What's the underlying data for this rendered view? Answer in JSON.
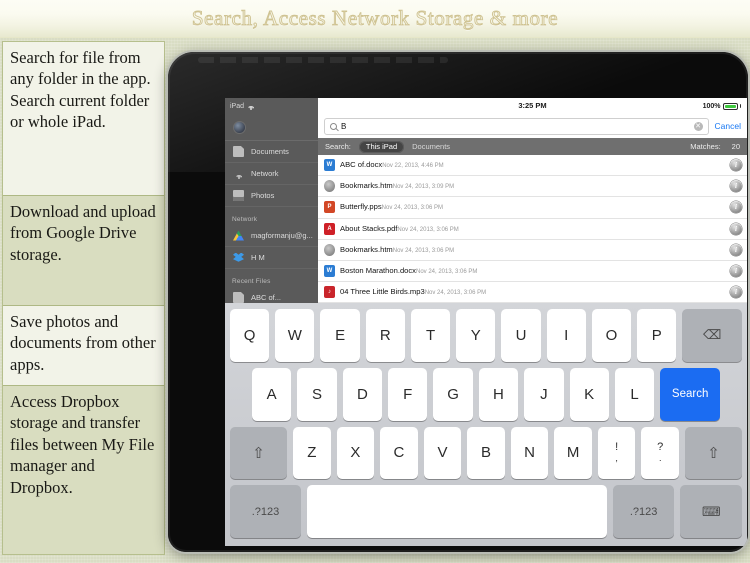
{
  "header": {
    "title": "Search, Access Network Storage & more"
  },
  "features": [
    {
      "text": "Search for file from any folder in the app.\nSearch current folder or whole iPad."
    },
    {
      "text": "Download and upload from Google Drive storage."
    },
    {
      "text": "Save photos and documents from other apps."
    },
    {
      "text": "Access Dropbox storage and transfer files between My File manager and Dropbox."
    }
  ],
  "device": {
    "status": {
      "carrier": "iPad",
      "time": "3:25 PM",
      "battery": "100%"
    },
    "search": {
      "value": "B",
      "placeholder": "Search",
      "cancel_label": "Cancel"
    },
    "scope": {
      "label": "Search:",
      "selected": "This iPad",
      "alt": "Documents",
      "matches_label": "Matches:",
      "matches_count": "20"
    },
    "sidebar": {
      "items": [
        {
          "label": "Documents",
          "icon": "document-icon"
        },
        {
          "label": "Network",
          "icon": "wifi-icon"
        },
        {
          "label": "Photos",
          "icon": "photo-icon"
        }
      ],
      "network_header": "Network",
      "network_items": [
        {
          "label": "magformanju@g...",
          "icon": "google-drive-icon"
        },
        {
          "label": "H M",
          "icon": "dropbox-icon"
        }
      ],
      "recent_header": "Recent Files",
      "recent_items": [
        {
          "label": "ABC of...",
          "icon": "document-icon"
        }
      ]
    },
    "files": [
      {
        "name": "ABC of.docx",
        "date": "Nov 22, 2013, 4:46 PM",
        "type": "word"
      },
      {
        "name": "Bookmarks.htm",
        "date": "Nov 24, 2013, 3:09 PM",
        "type": "htm"
      },
      {
        "name": "Butterfly.pps",
        "date": "Nov 24, 2013, 3:06 PM",
        "type": "ppt",
        "badge": "P"
      },
      {
        "name": "About Stacks.pdf",
        "date": "Nov 24, 2013, 3:06 PM",
        "type": "pdf",
        "badge": "A"
      },
      {
        "name": "Bookmarks.htm",
        "date": "Nov 24, 2013, 3:06 PM",
        "type": "htm"
      },
      {
        "name": "Boston Marathon.docx",
        "date": "Nov 24, 2013, 3:06 PM",
        "type": "word"
      },
      {
        "name": "04 Three Little Birds.mp3",
        "date": "Nov 24, 2013, 3:06 PM",
        "type": "mp3"
      }
    ],
    "keyboard": {
      "row1": [
        "Q",
        "W",
        "E",
        "R",
        "T",
        "Y",
        "U",
        "I",
        "O",
        "P"
      ],
      "backspace": "⌫",
      "row2": [
        "A",
        "S",
        "D",
        "F",
        "G",
        "H",
        "J",
        "K",
        "L"
      ],
      "search_key": "Search",
      "row3": [
        "Z",
        "X",
        "C",
        "V",
        "B",
        "N",
        "M"
      ],
      "shift": "⇧",
      "punct1_top": "!",
      "punct1_bottom": ",",
      "punct2_top": "?",
      "punct2_bottom": ".",
      "numeric_left": ".?123",
      "space": "",
      "numeric_right": ".?123",
      "dismiss": "⌨"
    }
  },
  "colors": {
    "accent_blue": "#1b6cf2",
    "cancel_blue": "#1878f3",
    "battery_green": "#3ec73e",
    "page_bg": "#d9ddc4",
    "title_gold": "#cfc392"
  }
}
